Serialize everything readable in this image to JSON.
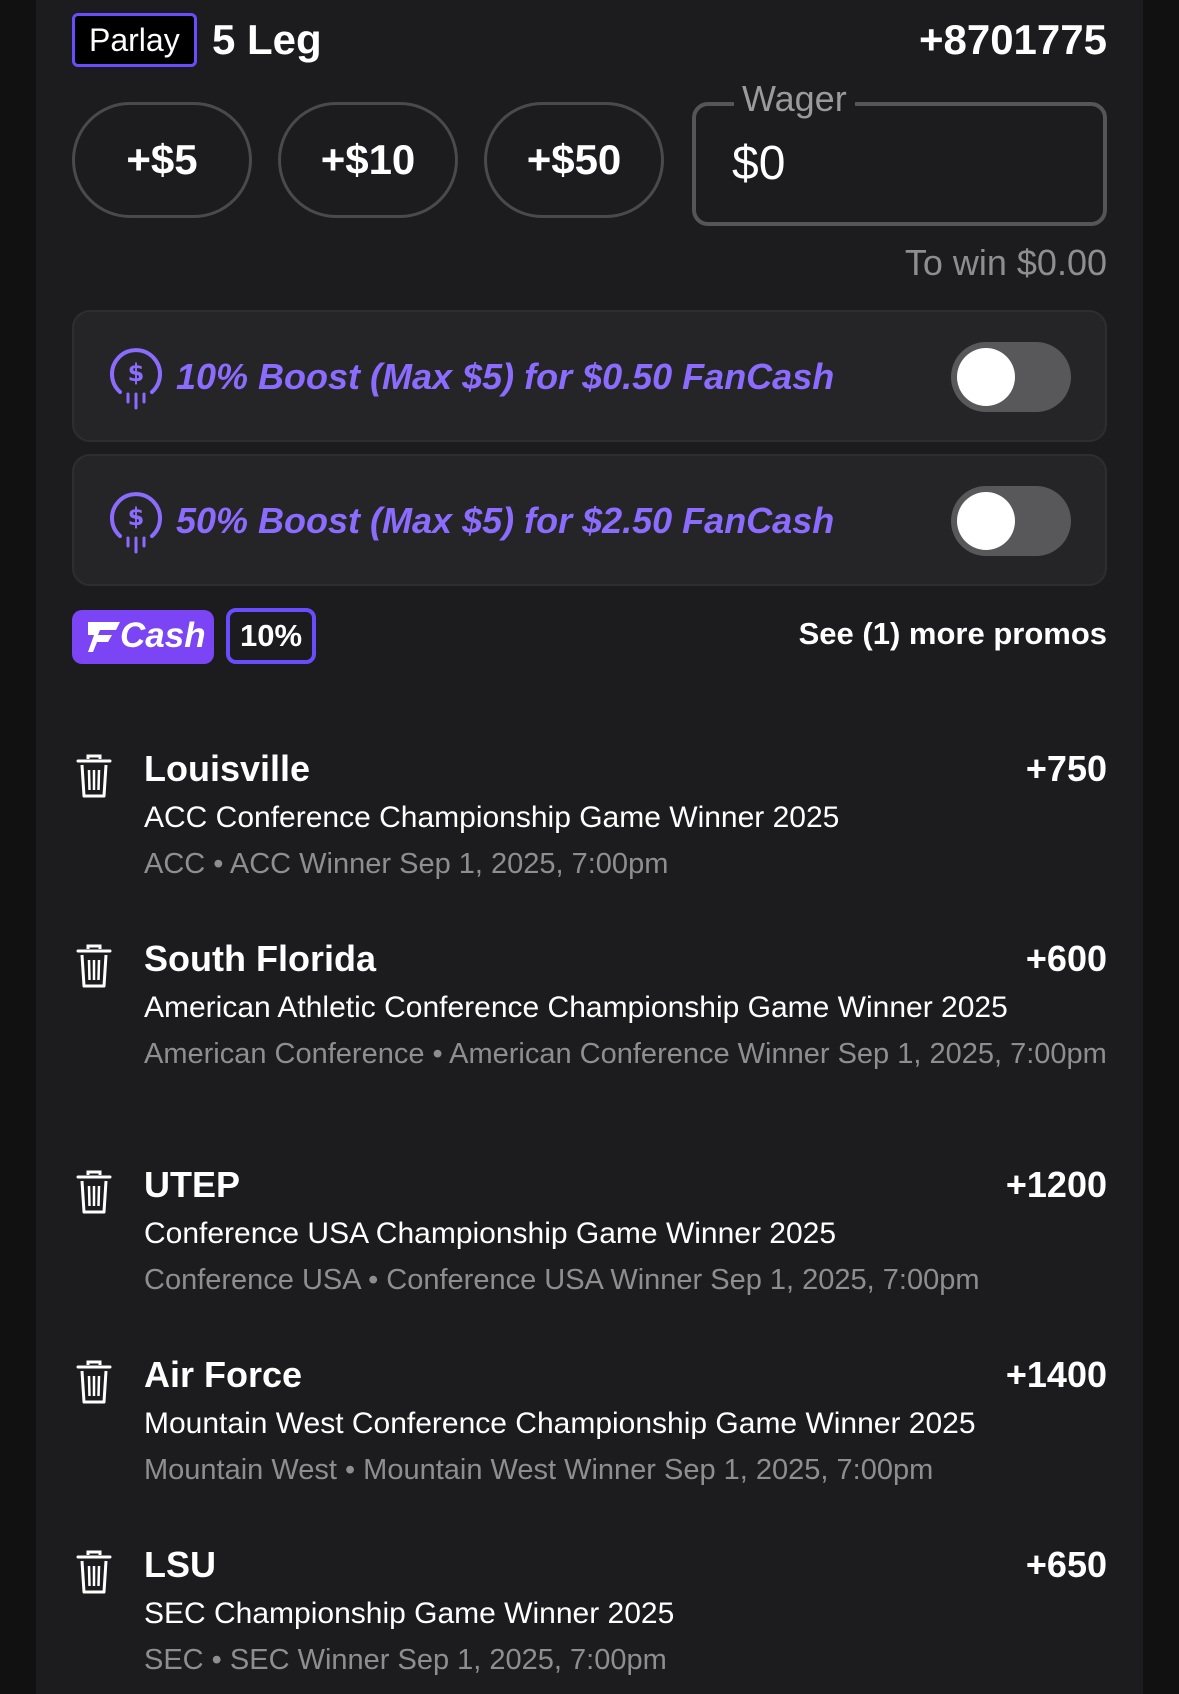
{
  "header": {
    "bet_type": "Parlay",
    "legs_label": "5 Leg",
    "total_odds": "+8701775"
  },
  "quick_add": [
    {
      "label": "+$5"
    },
    {
      "label": "+$10"
    },
    {
      "label": "+$50"
    }
  ],
  "wager": {
    "label": "Wager",
    "value": "$0",
    "to_win": "To win $0.00"
  },
  "boosts": [
    {
      "label": "10% Boost (Max $5) for $0.50 FanCash",
      "enabled": false
    },
    {
      "label": "50% Boost (Max $5) for $2.50 FanCash",
      "enabled": false
    }
  ],
  "promo": {
    "cash_label": "Cash",
    "percent": "10%",
    "more_link": "See (1) more promos"
  },
  "legs": [
    {
      "team": "Louisville",
      "odds": "+750",
      "market": "ACC Conference Championship Game Winner 2025",
      "meta": "ACC • ACC Winner Sep 1, 2025, 7:00pm"
    },
    {
      "team": "South Florida",
      "odds": "+600",
      "market": "American Athletic Conference Championship Game Winner 2025",
      "meta": "American Conference • American Conference Winner Sep 1, 2025, 7:00pm"
    },
    {
      "team": "UTEP",
      "odds": "+1200",
      "market": "Conference USA Championship Game Winner 2025",
      "meta": "Conference USA • Conference USA Winner Sep 1, 2025, 7:00pm"
    },
    {
      "team": "Air Force",
      "odds": "+1400",
      "market": "Mountain West Conference Championship Game Winner 2025",
      "meta": "Mountain West • Mountain West Winner Sep 1, 2025, 7:00pm"
    },
    {
      "team": "LSU",
      "odds": "+650",
      "market": "SEC Championship Game Winner 2025",
      "meta": "SEC • SEC Winner Sep 1, 2025, 7:00pm"
    }
  ],
  "colors": {
    "accent": "#6a4cff",
    "boost_text": "#8b6cff",
    "fancash_bg": "#7b44f5",
    "panel_bg": "#1c1c1e"
  }
}
